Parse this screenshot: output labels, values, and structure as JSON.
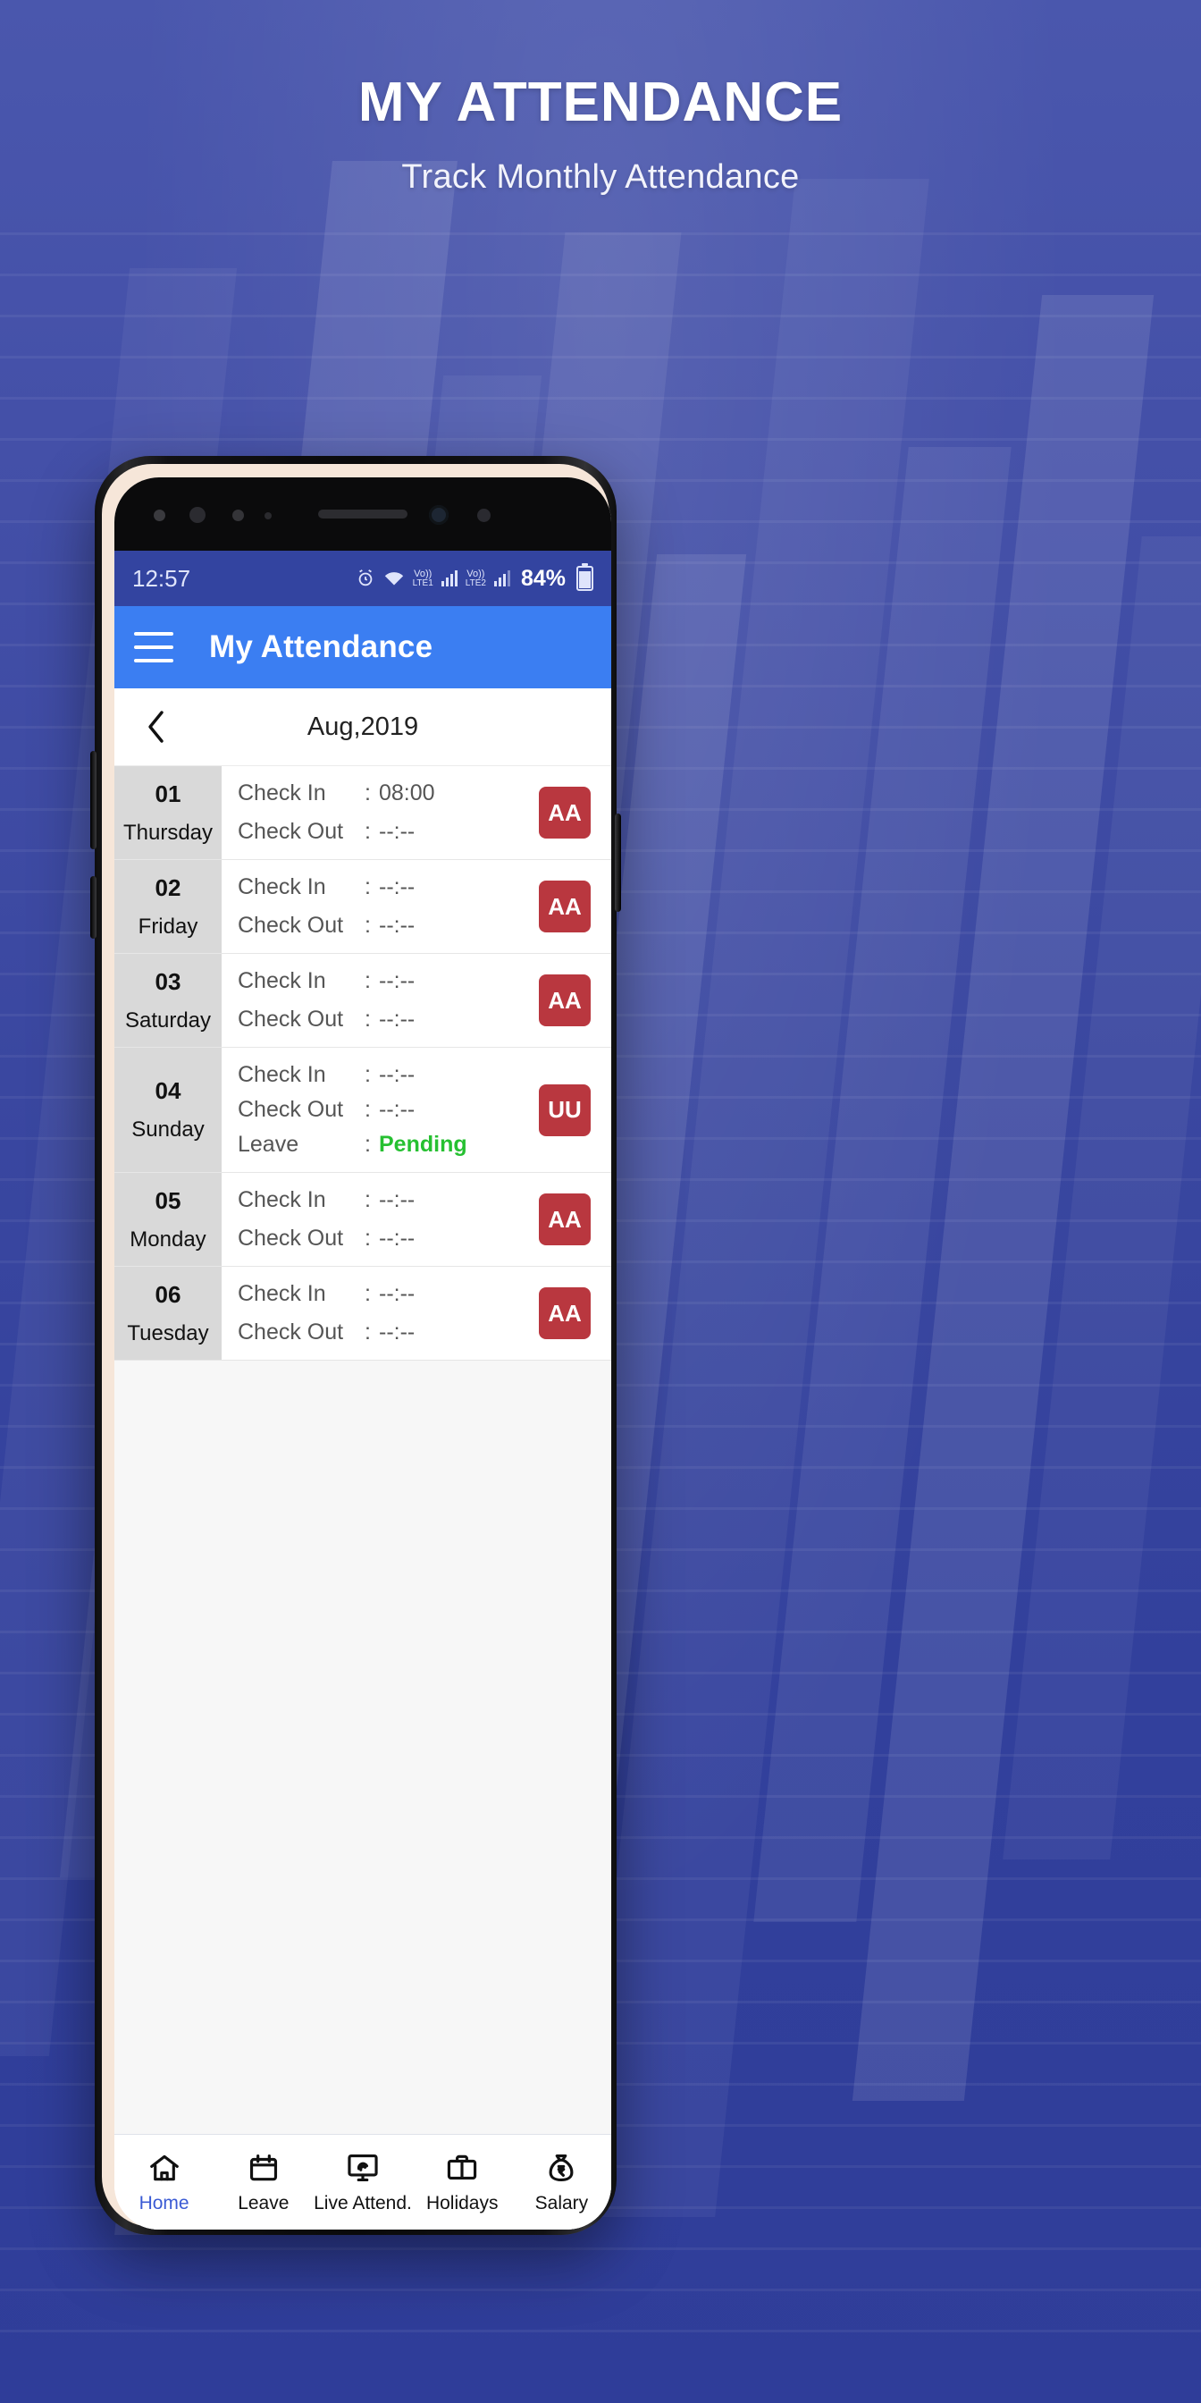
{
  "promo": {
    "headline": "MY ATTENDANCE",
    "subhead": "Track Monthly Attendance"
  },
  "status_bar": {
    "time": "12:57",
    "alarm_icon": "alarm-icon",
    "wifi_icon": "wifi-icon",
    "sim1_label_top": "Vo))",
    "sim1_label_bottom": "LTE1",
    "sim2_label_top": "Vo))",
    "sim2_label_bottom": "LTE2",
    "battery_percent": "84%",
    "battery_icon": "battery-icon"
  },
  "app_bar": {
    "menu_icon": "hamburger-menu-icon",
    "title": "My Attendance",
    "background": "#3b7ef2"
  },
  "month_bar": {
    "prev_icon": "chevron-left-icon",
    "label": "Aug,2019"
  },
  "labels": {
    "check_in": "Check In",
    "check_out": "Check Out",
    "leave": "Leave",
    "colon": ":"
  },
  "colors": {
    "badge_red": "#b9373f",
    "pending_green": "#26c031",
    "appbar_blue": "#3b7ef2",
    "statusbar_blue": "#3344a0",
    "active_nav": "#3b5bd4"
  },
  "rows": [
    {
      "day_number": "01",
      "day_name": "Thursday",
      "check_in": "08:00",
      "check_out": "--:--",
      "leave": null,
      "badge": "AA"
    },
    {
      "day_number": "02",
      "day_name": "Friday",
      "check_in": "--:--",
      "check_out": "--:--",
      "leave": null,
      "badge": "AA"
    },
    {
      "day_number": "03",
      "day_name": "Saturday",
      "check_in": "--:--",
      "check_out": "--:--",
      "leave": null,
      "badge": "AA"
    },
    {
      "day_number": "04",
      "day_name": "Sunday",
      "check_in": "--:--",
      "check_out": "--:--",
      "leave": "Pending",
      "badge": "UU"
    },
    {
      "day_number": "05",
      "day_name": "Monday",
      "check_in": "--:--",
      "check_out": "--:--",
      "leave": null,
      "badge": "AA"
    },
    {
      "day_number": "06",
      "day_name": "Tuesday",
      "check_in": "--:--",
      "check_out": "--:--",
      "leave": null,
      "badge": "AA"
    }
  ],
  "bottom_nav": [
    {
      "label": "Home",
      "icon": "home-icon",
      "active": true
    },
    {
      "label": "Leave",
      "icon": "calendar-icon",
      "active": false
    },
    {
      "label": "Live Attend.",
      "icon": "fingerprint-monitor-icon",
      "active": false
    },
    {
      "label": "Holidays",
      "icon": "briefcase-icon",
      "active": false
    },
    {
      "label": "Salary",
      "icon": "money-bag-icon",
      "active": false
    }
  ]
}
